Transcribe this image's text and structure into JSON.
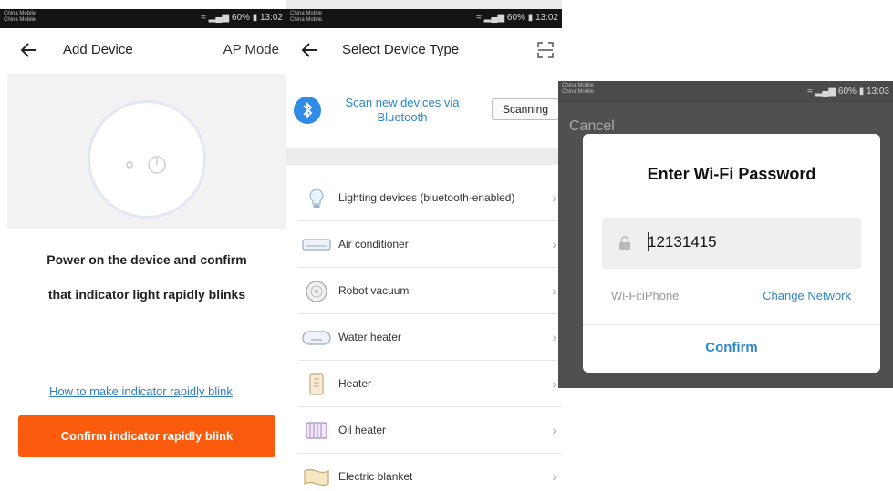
{
  "status_bar": {
    "carrier_1": "China Mobile",
    "carrier_2": "China Mobile",
    "battery": "60%",
    "time_p1": "13:02",
    "time_p2": "13:02",
    "time_p3": "13:03"
  },
  "add_device": {
    "title": "Add Device",
    "mode": "AP Mode",
    "instruction_line1": "Power on the device and confirm",
    "instruction_line2": "that indicator light rapidly blinks",
    "help_link": "How to make indicator rapidly blink",
    "confirm_button": "Confirm indicator rapidly blink",
    "accent_color": "#fb5b0d"
  },
  "select_device_type": {
    "title": "Select Device Type",
    "bluetooth_text": "Scan new devices via Bluetooth",
    "scan_button": "Scanning",
    "items": [
      {
        "label": "Lighting devices (bluetooth-enabled)",
        "icon": "lightbulb-icon"
      },
      {
        "label": "Air conditioner",
        "icon": "air-conditioner-icon"
      },
      {
        "label": "Robot vacuum",
        "icon": "robot-vacuum-icon"
      },
      {
        "label": "Water heater",
        "icon": "water-heater-icon"
      },
      {
        "label": "Heater",
        "icon": "heater-icon"
      },
      {
        "label": "Oil heater",
        "icon": "oil-heater-icon"
      },
      {
        "label": "Electric blanket",
        "icon": "electric-blanket-icon"
      }
    ]
  },
  "wifi_dialog": {
    "cancel": "Cancel",
    "title": "Enter Wi-Fi Password",
    "password": "12131415",
    "network_label": "Wi-Fi:iPhone",
    "change_network": "Change Network",
    "confirm": "Confirm",
    "link_color": "#2f86c8"
  }
}
